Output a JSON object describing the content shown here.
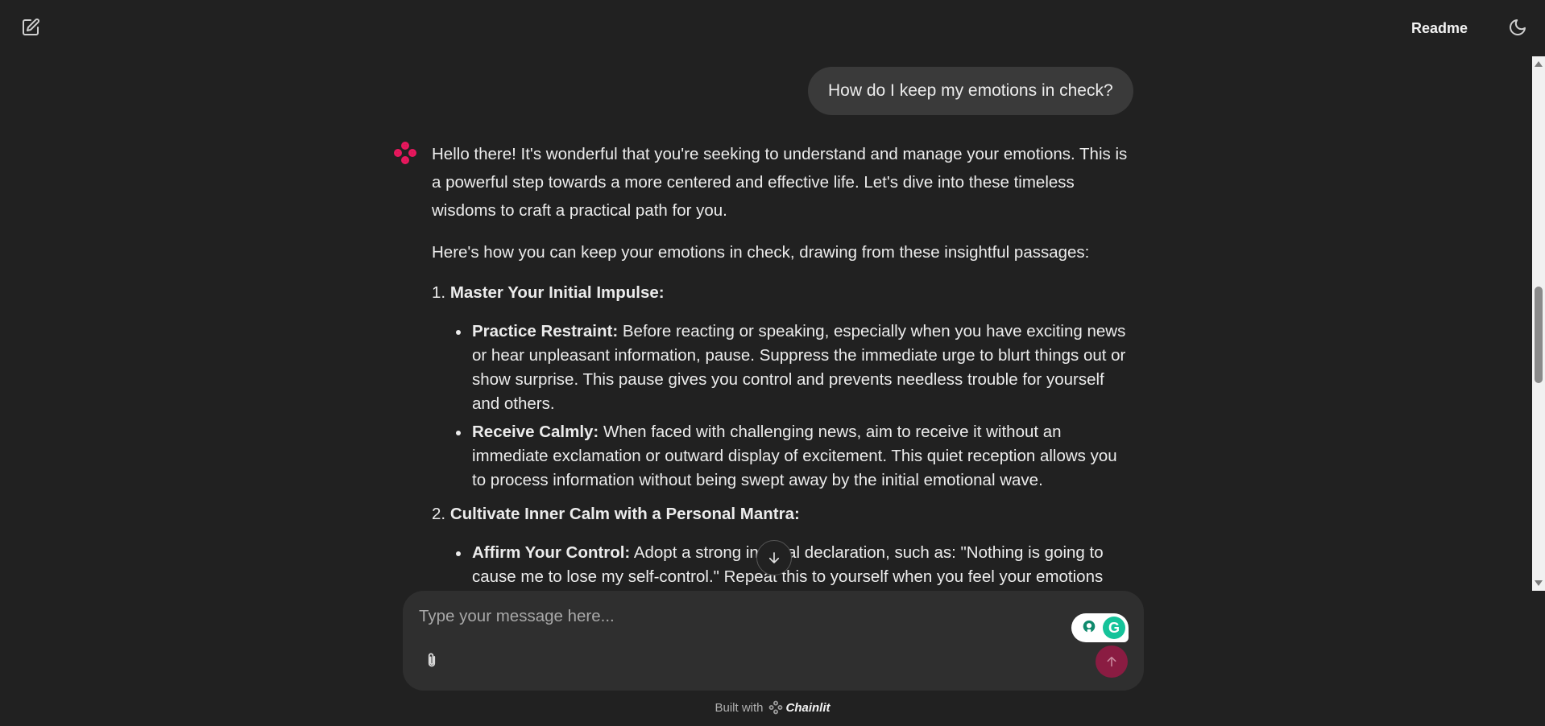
{
  "header": {
    "new_chat_icon": "edit-square-icon",
    "readme_label": "Readme",
    "theme_icon": "moon-icon"
  },
  "conversation": {
    "user_message": "How do I keep my emotions in check?",
    "assistant": {
      "avatar_icon": "chainlit-logo-icon",
      "avatar_color": "#e8175d",
      "intro": "Hello there! It's wonderful that you're seeking to understand and manage your emotions. This is a powerful step towards a more centered and effective life. Let's dive into these timeless wisdoms to craft a practical path for you.",
      "intro2": "Here's how you can keep your emotions in check, drawing from these insightful passages:",
      "sections": [
        {
          "number": "1.",
          "title": "Master Your Initial Impulse:",
          "bullets": [
            {
              "bold": "Practice Restraint:",
              "text": " Before reacting or speaking, especially when you have exciting news or hear unpleasant information, pause. Suppress the immediate urge to blurt things out or show surprise. This pause gives you control and prevents needless trouble for yourself and others."
            },
            {
              "bold": "Receive Calmly:",
              "text": " When faced with challenging news, aim to receive it without an immediate exclamation or outward display of excitement. This quiet reception allows you to process information without being swept away by the initial emotional wave."
            }
          ]
        },
        {
          "number": "2.",
          "title": "Cultivate Inner Calm with a Personal Mantra:",
          "bullets": [
            {
              "bold": "Affirm Your Control:",
              "text": " Adopt a strong internal declaration, such as: \"Nothing is going to cause me to lose my self-control.\" Repeat this to yourself when you feel your emotions"
            }
          ]
        }
      ]
    },
    "scroll_down_icon": "arrow-down-icon"
  },
  "composer": {
    "placeholder": "Type your message here...",
    "attach_icon": "paperclip-icon",
    "send_icon": "arrow-up-icon",
    "send_color": "#8a1c42",
    "grammarly": {
      "bulb_icon": "lightbulb-icon",
      "logo": "G",
      "color": "#15c39a"
    }
  },
  "footer": {
    "built_with": "Built with",
    "brand": "Chainlit"
  }
}
